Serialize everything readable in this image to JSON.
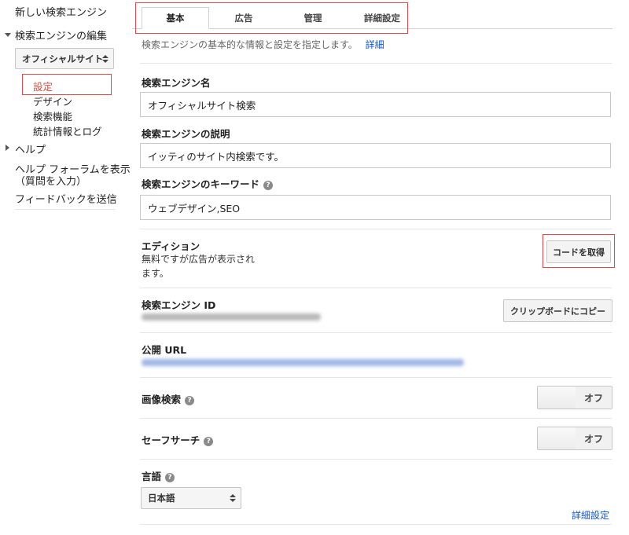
{
  "sidebar": {
    "new_engine": "新しい検索エンジン",
    "edit_engine": "検索エンジンの編集",
    "engine_select": "オフィシャルサイト",
    "sub_items": [
      "設定",
      "デザイン",
      "検索機能",
      "統計情報とログ"
    ],
    "help": "ヘルプ",
    "forum_line1": "ヘルプ フォーラムを表示",
    "forum_line2": "（質問を入力）",
    "feedback": "フィードバックを送信"
  },
  "tabs": [
    "基本",
    "広告",
    "管理",
    "詳細設定"
  ],
  "intro": {
    "text": "検索エンジンの基本的な情報と設定を指定します。",
    "link": "詳細"
  },
  "fields": {
    "name": {
      "label": "検索エンジン名",
      "value": "オフィシャルサイト検索"
    },
    "description": {
      "label": "検索エンジンの説明",
      "value": "イッティのサイト内検索です。"
    },
    "keywords": {
      "label": "検索エンジンのキーワード",
      "value": "ウェブデザイン,SEO"
    }
  },
  "edition": {
    "label": "エディション",
    "text_line1": "無料ですが広告が表示され",
    "text_line2": "ます。",
    "button": "コードを取得"
  },
  "engine_id": {
    "label": "検索エンジン ID",
    "button": "クリップボードにコピー"
  },
  "public_url": {
    "label": "公開 URL"
  },
  "image_search": {
    "label": "画像検索",
    "state": "オフ"
  },
  "safe_search": {
    "label": "セーフサーチ",
    "state": "オフ"
  },
  "language": {
    "label": "言語",
    "value": "日本語"
  },
  "advanced_link": "詳細設定",
  "colors": {
    "link": "#1155cc",
    "highlight": "#e0494c",
    "active_sub": "#dd4b39"
  },
  "icons": [
    "triangle-down-icon",
    "triangle-right-icon",
    "help-icon",
    "select-arrows-icon"
  ]
}
